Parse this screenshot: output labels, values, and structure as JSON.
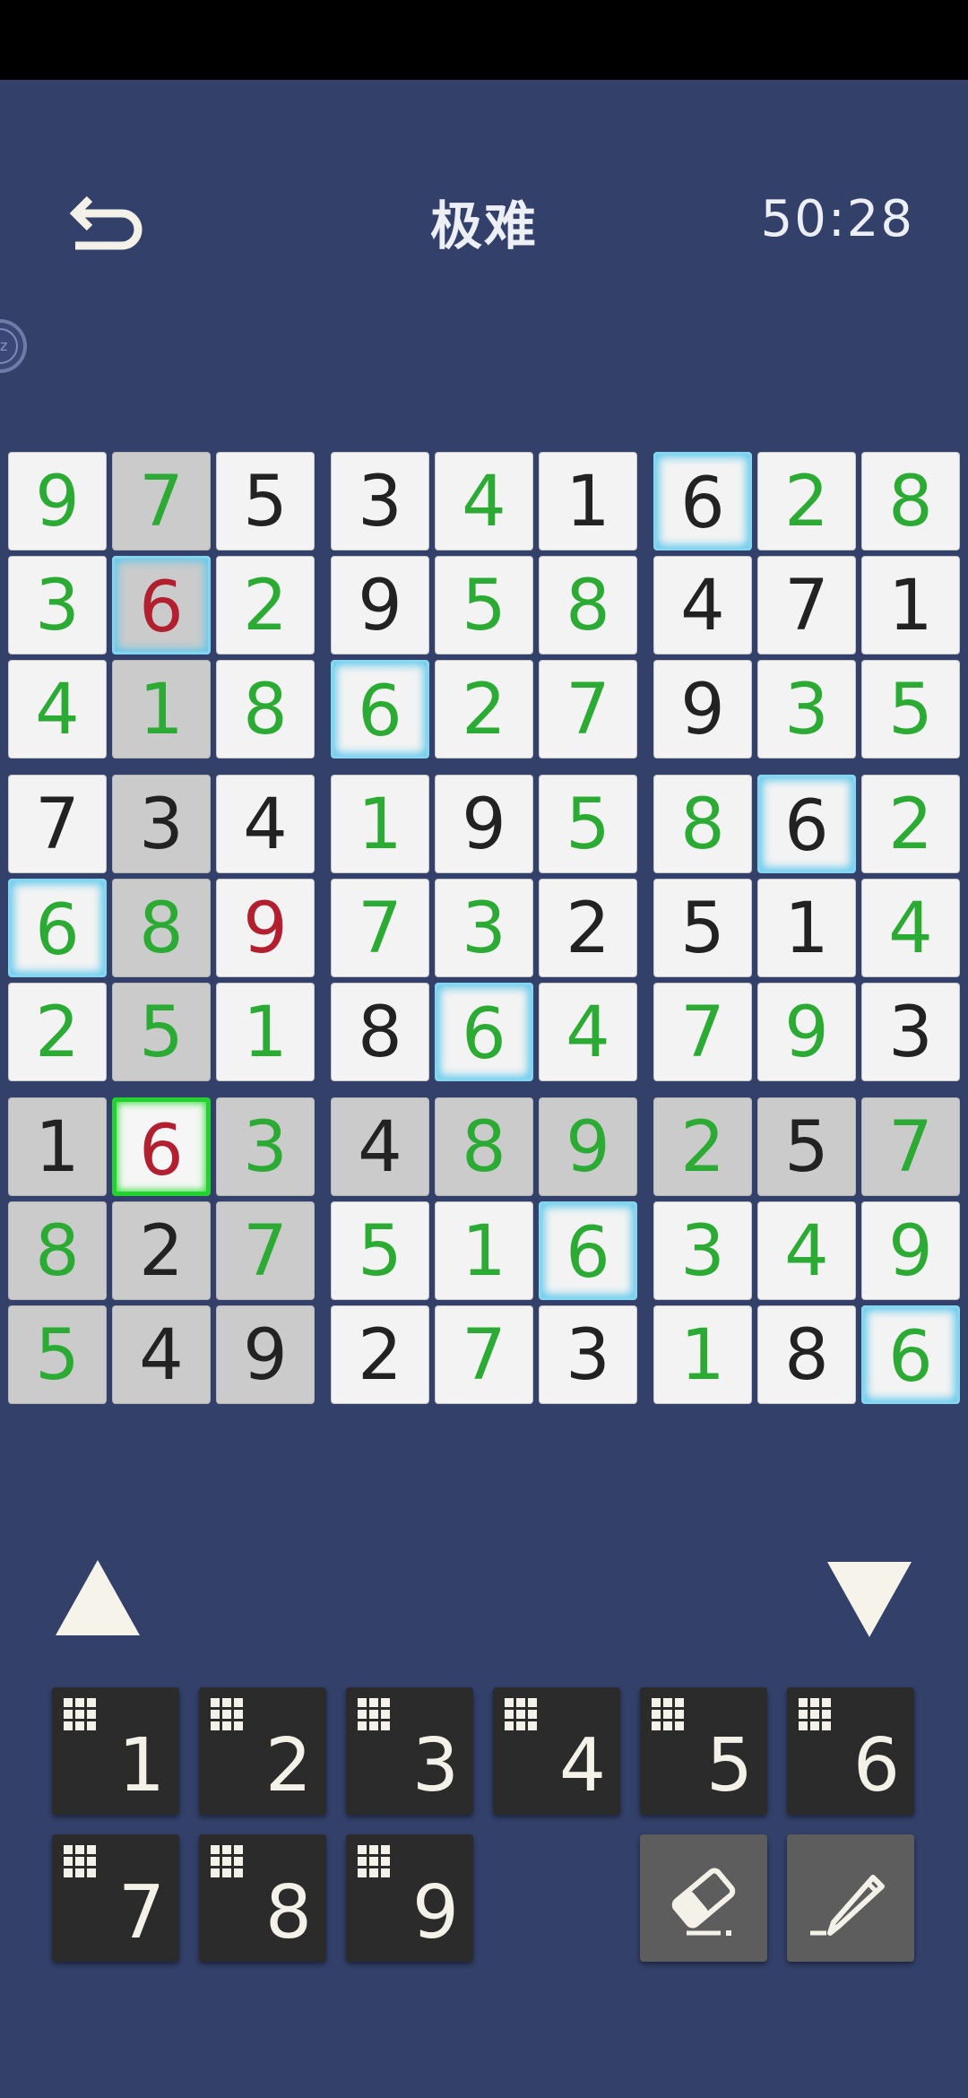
{
  "header": {
    "title": "极难",
    "timer": "50:28"
  },
  "sleep_label": "zz",
  "board": [
    [
      {
        "v": "9",
        "c": "g"
      },
      {
        "v": "7",
        "c": "g",
        "hl": 1
      },
      {
        "v": "5",
        "c": "b"
      },
      {
        "v": "3",
        "c": "b"
      },
      {
        "v": "4",
        "c": "g"
      },
      {
        "v": "1",
        "c": "b"
      },
      {
        "v": "6",
        "c": "b",
        "same": 1
      },
      {
        "v": "2",
        "c": "g"
      },
      {
        "v": "8",
        "c": "g"
      }
    ],
    [
      {
        "v": "3",
        "c": "g"
      },
      {
        "v": "6",
        "c": "r",
        "hl": 1,
        "same": 1
      },
      {
        "v": "2",
        "c": "g"
      },
      {
        "v": "9",
        "c": "b"
      },
      {
        "v": "5",
        "c": "g"
      },
      {
        "v": "8",
        "c": "g"
      },
      {
        "v": "4",
        "c": "b"
      },
      {
        "v": "7",
        "c": "b"
      },
      {
        "v": "1",
        "c": "b"
      }
    ],
    [
      {
        "v": "4",
        "c": "g"
      },
      {
        "v": "1",
        "c": "g",
        "hl": 1
      },
      {
        "v": "8",
        "c": "g"
      },
      {
        "v": "6",
        "c": "g",
        "same": 1
      },
      {
        "v": "2",
        "c": "g"
      },
      {
        "v": "7",
        "c": "g"
      },
      {
        "v": "9",
        "c": "b"
      },
      {
        "v": "3",
        "c": "g"
      },
      {
        "v": "5",
        "c": "g"
      }
    ],
    [
      {
        "v": "7",
        "c": "b"
      },
      {
        "v": "3",
        "c": "b",
        "hl": 1
      },
      {
        "v": "4",
        "c": "b"
      },
      {
        "v": "1",
        "c": "g"
      },
      {
        "v": "9",
        "c": "b"
      },
      {
        "v": "5",
        "c": "g"
      },
      {
        "v": "8",
        "c": "g"
      },
      {
        "v": "6",
        "c": "b",
        "same": 1
      },
      {
        "v": "2",
        "c": "g"
      }
    ],
    [
      {
        "v": "6",
        "c": "g",
        "same": 1
      },
      {
        "v": "8",
        "c": "g",
        "hl": 1
      },
      {
        "v": "9",
        "c": "r"
      },
      {
        "v": "7",
        "c": "g"
      },
      {
        "v": "3",
        "c": "g"
      },
      {
        "v": "2",
        "c": "b"
      },
      {
        "v": "5",
        "c": "b"
      },
      {
        "v": "1",
        "c": "b"
      },
      {
        "v": "4",
        "c": "g"
      }
    ],
    [
      {
        "v": "2",
        "c": "g"
      },
      {
        "v": "5",
        "c": "g",
        "hl": 1
      },
      {
        "v": "1",
        "c": "g"
      },
      {
        "v": "8",
        "c": "b"
      },
      {
        "v": "6",
        "c": "g",
        "same": 1
      },
      {
        "v": "4",
        "c": "g"
      },
      {
        "v": "7",
        "c": "g"
      },
      {
        "v": "9",
        "c": "g"
      },
      {
        "v": "3",
        "c": "b"
      }
    ],
    [
      {
        "v": "1",
        "c": "b",
        "hl": 1
      },
      {
        "v": "6",
        "c": "r",
        "sel": 1
      },
      {
        "v": "3",
        "c": "g",
        "hl": 1
      },
      {
        "v": "4",
        "c": "b",
        "hl": 1
      },
      {
        "v": "8",
        "c": "g",
        "hl": 1
      },
      {
        "v": "9",
        "c": "g",
        "hl": 1
      },
      {
        "v": "2",
        "c": "g",
        "hl": 1
      },
      {
        "v": "5",
        "c": "b",
        "hl": 1
      },
      {
        "v": "7",
        "c": "g",
        "hl": 1
      }
    ],
    [
      {
        "v": "8",
        "c": "g",
        "hl": 1
      },
      {
        "v": "2",
        "c": "b",
        "hl": 1
      },
      {
        "v": "7",
        "c": "g",
        "hl": 1
      },
      {
        "v": "5",
        "c": "g"
      },
      {
        "v": "1",
        "c": "g"
      },
      {
        "v": "6",
        "c": "g",
        "same": 1
      },
      {
        "v": "3",
        "c": "g"
      },
      {
        "v": "4",
        "c": "g"
      },
      {
        "v": "9",
        "c": "g"
      }
    ],
    [
      {
        "v": "5",
        "c": "g",
        "hl": 1
      },
      {
        "v": "4",
        "c": "b",
        "hl": 1
      },
      {
        "v": "9",
        "c": "b",
        "hl": 1
      },
      {
        "v": "2",
        "c": "b"
      },
      {
        "v": "7",
        "c": "g"
      },
      {
        "v": "3",
        "c": "b"
      },
      {
        "v": "1",
        "c": "g"
      },
      {
        "v": "8",
        "c": "b"
      },
      {
        "v": "6",
        "c": "g",
        "same": 1
      }
    ]
  ],
  "keypad": {
    "digits": [
      "1",
      "2",
      "3",
      "4",
      "5",
      "6",
      "7",
      "8",
      "9"
    ],
    "tools": [
      "eraser-icon",
      "pencil-icon"
    ]
  },
  "icons": {
    "back": "back-arrow-icon",
    "up": "arrow-up-icon",
    "down": "arrow-down-icon",
    "notes": "notes-grid-icon"
  },
  "colors": {
    "given": "#222222",
    "filled": "#2bab33",
    "error": "#b21f2f",
    "background": "#33406a",
    "selected": "#23d12f",
    "same_value": "#5ec8ec"
  }
}
